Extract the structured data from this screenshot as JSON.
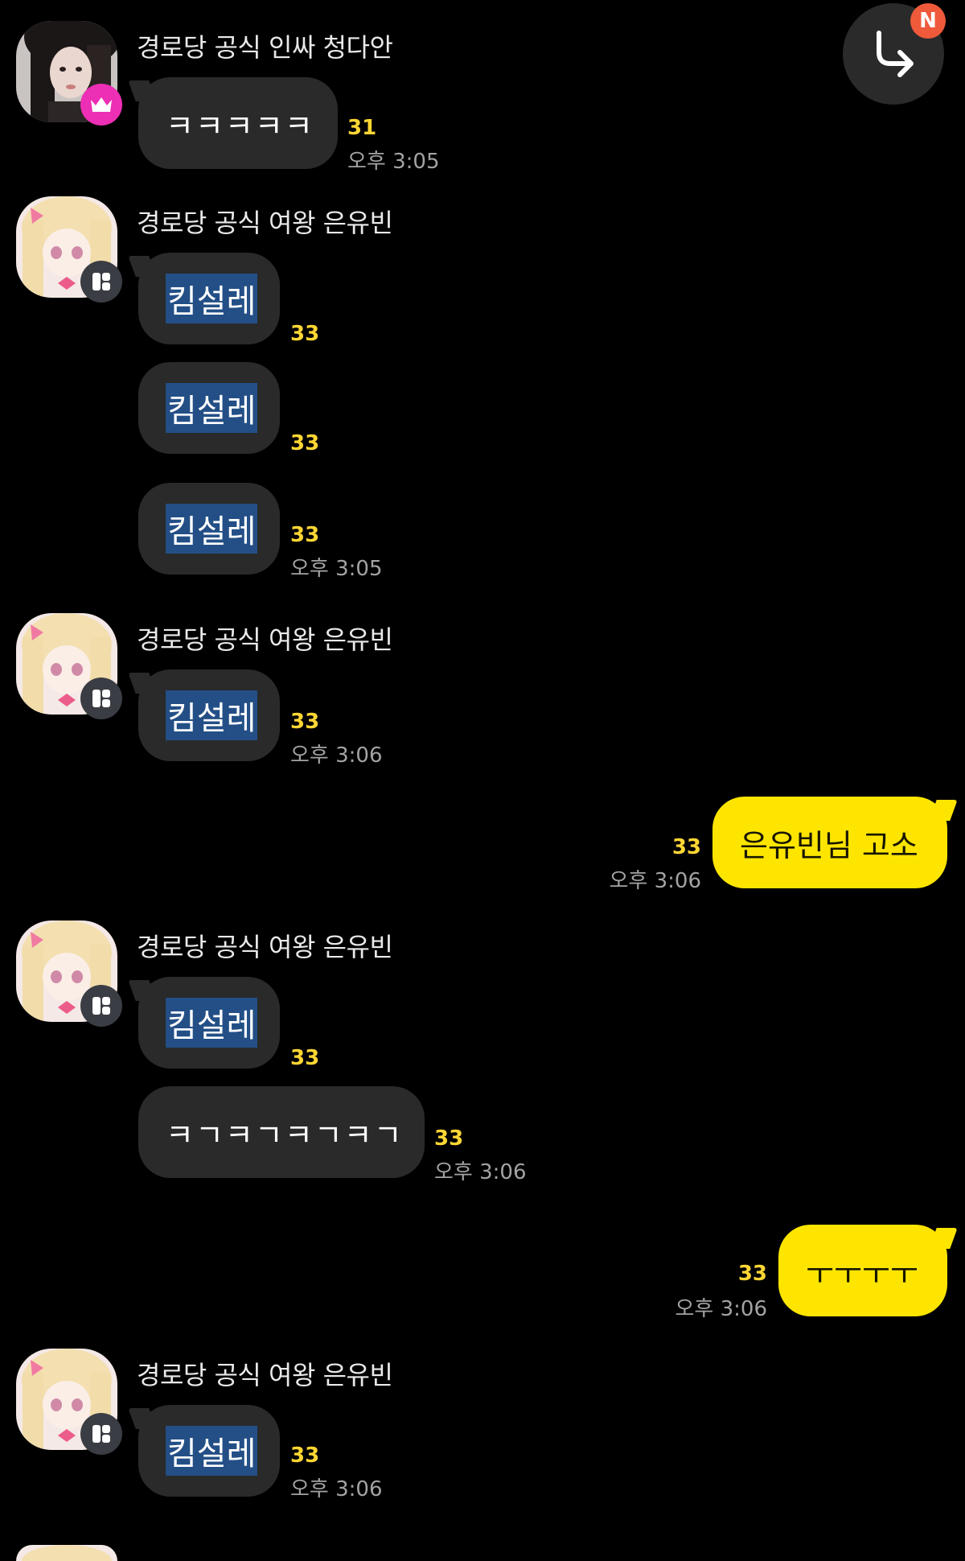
{
  "colors": {
    "background": "#000000",
    "bubble_other": "#2a2a2b",
    "bubble_mine": "#fee500",
    "unread_count": "#ffd633",
    "selection": "#234f86",
    "crown_badge": "#ec2fb4",
    "new_badge": "#ee5a3a"
  },
  "shortcut": {
    "icon": "reply-arrow-icon",
    "badge": "N"
  },
  "messages": [
    {
      "sender": "경로당 공식 인싸 청다안",
      "avatar_badge_icon": "crown-icon",
      "bubbles": [
        {
          "text": "ㅋㅋㅋㅋㅋ",
          "unread": "31",
          "time": "오후 3:05"
        }
      ]
    },
    {
      "sender": "경로당 공식 여왕 은유빈",
      "avatar_badge_icon": "bot-icon",
      "bubbles": [
        {
          "text": "킴설레",
          "unread": "33",
          "time": ""
        },
        {
          "text": "킴설레",
          "unread": "33",
          "time": ""
        },
        {
          "text": "킴설레",
          "unread": "33",
          "time": "오후 3:05"
        }
      ]
    },
    {
      "sender": "경로당 공식 여왕 은유빈",
      "avatar_badge_icon": "bot-icon",
      "bubbles": [
        {
          "text": "킴설레",
          "unread": "33",
          "time": "오후 3:06"
        }
      ]
    },
    {
      "mine": true,
      "bubbles": [
        {
          "text": "은유빈님 고소",
          "unread": "33",
          "time": "오후 3:06"
        }
      ]
    },
    {
      "sender": "경로당 공식 여왕 은유빈",
      "avatar_badge_icon": "bot-icon",
      "bubbles": [
        {
          "text": "킴설레",
          "unread": "33",
          "time": ""
        },
        {
          "text": "ㅋㄱㅋㄱㅋㄱㅋㄱ",
          "unread": "33",
          "time": "오후 3:06"
        }
      ]
    },
    {
      "mine": true,
      "bubbles": [
        {
          "text": "ㅜㅜㅜㅜ",
          "unread": "33",
          "time": "오후 3:06"
        }
      ]
    },
    {
      "sender": "경로당 공식 여왕 은유빈",
      "avatar_badge_icon": "bot-icon",
      "bubbles": [
        {
          "text": "킴설레",
          "unread": "33",
          "time": "오후 3:06"
        }
      ]
    }
  ]
}
